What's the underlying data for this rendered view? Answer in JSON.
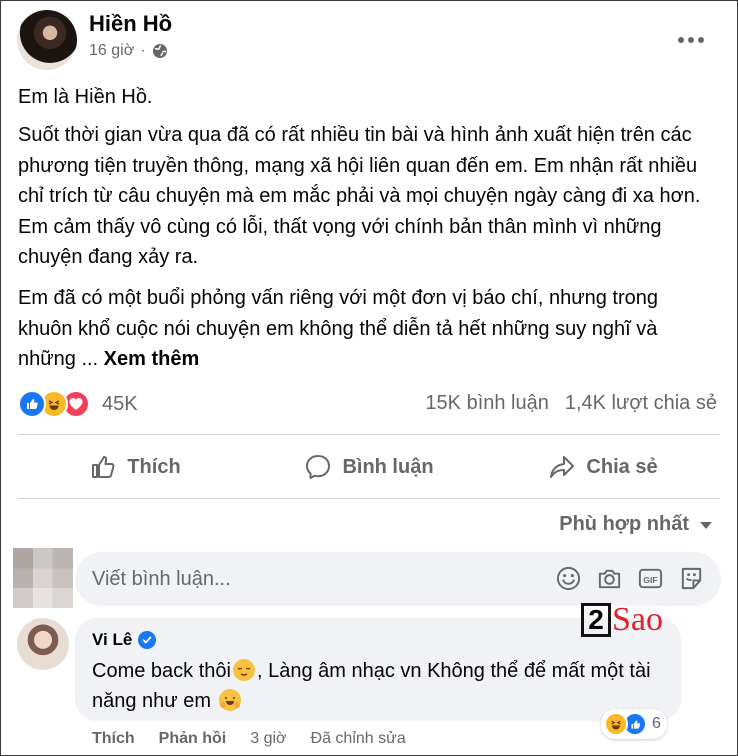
{
  "post": {
    "author": "Hiền Hồ",
    "time": "16 giờ",
    "separator": "·",
    "paragraphs": [
      "Em là Hiền Hồ.",
      "Suốt thời gian vừa qua đã có rất nhiều tin bài và hình ảnh xuất hiện trên các phương tiện truyền thông, mạng xã hội liên quan đến em. Em nhận rất nhiều chỉ trích từ câu chuyện mà em mắc phải và mọi chuyện ngày càng đi xa hơn. Em cảm thấy vô cùng có lỗi, thất vọng với chính bản thân mình vì những chuyện đang xảy ra.",
      "Em đã có một buổi phỏng vấn riêng với một đơn vị báo chí, nhưng trong khuôn khổ cuộc nói chuyện em không thể diễn tả hết những suy nghĩ và những ... "
    ],
    "see_more": "Xem thêm",
    "reaction_count": "45K",
    "comments_count": "15K bình luận",
    "shares_count": "1,4K lượt chia sẻ"
  },
  "actions": {
    "like": "Thích",
    "comment": "Bình luận",
    "share": "Chia sẻ"
  },
  "sort_label": "Phù hợp nhất",
  "comment_input": {
    "placeholder": "Viết bình luận..."
  },
  "watermark": {
    "number": "2",
    "text": "Sao"
  },
  "comment": {
    "author": "Vi Lê",
    "text_part1": "Come back thôi",
    "text_part2": ", Làng âm nhạc vn Không thể để mất một tài năng như em ",
    "react_count": "6",
    "like": "Thích",
    "reply": "Phản hồi",
    "time": "3 giờ",
    "edited": "Đã chỉnh sửa"
  },
  "colors": {
    "facebook_blue": "#1877f2",
    "secondary_text": "#65676b",
    "input_bg": "#f0f2f5",
    "love_red": "#f33e58",
    "haha_yellow": "#f7b928",
    "watermark_red": "#e0202a"
  },
  "icons": {
    "privacy": "globe-icon",
    "more": "more-horizontal-icon",
    "like": "thumbs-up-icon",
    "comment": "speech-bubble-icon",
    "share": "share-arrow-icon",
    "sort": "caret-down-icon",
    "emoji": "smiley-icon",
    "camera": "camera-icon",
    "gif": "gif-icon",
    "sticker": "sticker-icon",
    "verified": "verified-badge-icon"
  }
}
